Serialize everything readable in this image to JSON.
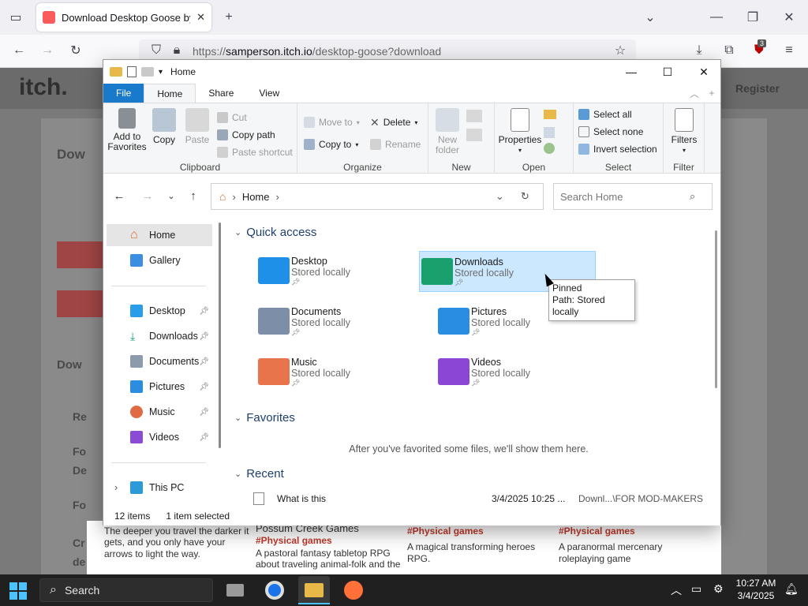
{
  "browser": {
    "tab_title": "Download Desktop Goose by sa",
    "url_prefix": "https://",
    "url_host": "samperson.itch.io",
    "url_path": "/desktop-goose?download",
    "ext_badge": "3"
  },
  "background_page": {
    "logo_text": "itch.",
    "register": "Register",
    "heading_fragments": [
      "Dow",
      "Dow",
      "Re",
      "Fo",
      "De",
      "Fo",
      "Cr",
      "de"
    ],
    "games": [
      {
        "title": "",
        "tag": "",
        "desc": "The deeper you travel the darker it gets, and you only have your arrows to light the way."
      },
      {
        "title": "Possum Creek Games",
        "tag": "#Physical games",
        "desc": "A pastoral fantasy tabletop RPG about traveling animal-folk and the"
      },
      {
        "title": "",
        "tag": "#Physical games",
        "desc": "A magical transforming heroes RPG."
      },
      {
        "title": "",
        "tag": "#Physical games",
        "desc": "A paranormal mercenary roleplaying game"
      }
    ]
  },
  "explorer": {
    "title": "Home",
    "ribbon_tabs": [
      "File",
      "Home",
      "Share",
      "View"
    ],
    "clipboard": {
      "add_to_favorites": "Add to\nFavorites",
      "copy": "Copy",
      "paste": "Paste",
      "cut": "Cut",
      "copy_path": "Copy path",
      "paste_shortcut": "Paste shortcut",
      "label": "Clipboard"
    },
    "organize": {
      "move_to": "Move to",
      "copy_to": "Copy to",
      "delete": "Delete",
      "rename": "Rename",
      "label": "Organize"
    },
    "new": {
      "new_folder": "New\nfolder",
      "label": "New"
    },
    "open": {
      "properties": "Properties",
      "label": "Open"
    },
    "select": {
      "select_all": "Select all",
      "select_none": "Select none",
      "invert_selection": "Invert selection",
      "label": "Select"
    },
    "filter": {
      "filters": "Filters",
      "label": "Filter"
    },
    "breadcrumb": "Home",
    "search_placeholder": "Search Home",
    "nav": {
      "home": "Home",
      "gallery": "Gallery",
      "desktop": "Desktop",
      "downloads": "Downloads",
      "documents": "Documents",
      "pictures": "Pictures",
      "music": "Music",
      "videos": "Videos",
      "this_pc": "This PC"
    },
    "quick_access_header": "Quick access",
    "favorites_header": "Favorites",
    "favorites_empty": "After you've favorited some files, we'll show them here.",
    "recent_header": "Recent",
    "quick_access": [
      {
        "name": "Desktop",
        "sub": "Stored locally",
        "color": "#1e90e8"
      },
      {
        "name": "Downloads",
        "sub": "Stored locally",
        "color": "#1aa06d"
      },
      {
        "name": "Documents",
        "sub": "Stored locally",
        "color": "#7d8fa8"
      },
      {
        "name": "Pictures",
        "sub": "Stored locally",
        "color": "#2a8ee0"
      },
      {
        "name": "Music",
        "sub": "Stored locally",
        "color": "#e8744c"
      },
      {
        "name": "Videos",
        "sub": "Stored locally",
        "color": "#8b46d6"
      }
    ],
    "recent_item": {
      "name": "What is this",
      "date": "3/4/2025 10:25 ...",
      "location": "Downl...\\FOR MOD-MAKERS"
    },
    "tooltip": {
      "line1": "Pinned",
      "line2": "Path: Stored locally"
    },
    "status": {
      "items": "12 items",
      "selected": "1 item selected"
    }
  },
  "taskbar": {
    "search": "Search",
    "time": "10:27 AM",
    "date": "3/4/2025"
  },
  "colors": {
    "accent": "#1979ca",
    "selection": "#cce8ff",
    "section_header": "#1e3f6f"
  }
}
